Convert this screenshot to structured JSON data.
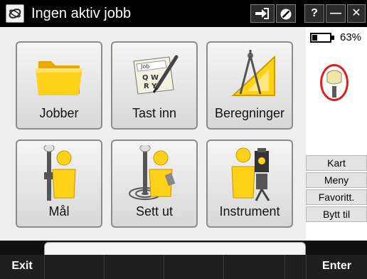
{
  "titlebar": {
    "title": "Ingen aktiv jobb",
    "app_icon": "trimble-logo-icon",
    "help_label": "?",
    "minimize_label": "—",
    "close_label": "✕"
  },
  "status": {
    "battery_percent": "63%",
    "battery_level": 0.63
  },
  "tiles": [
    {
      "label": "Jobber",
      "icon": "folder-icon"
    },
    {
      "label": "Tast inn",
      "icon": "keyin-card-icon"
    },
    {
      "label": "Beregninger",
      "icon": "compass-triangle-icon"
    },
    {
      "label": "Mål",
      "icon": "surveyor-measure-icon"
    },
    {
      "label": "Sett ut",
      "icon": "surveyor-stakeout-icon"
    },
    {
      "label": "Instrument",
      "icon": "surveyor-instrument-icon"
    }
  ],
  "side_buttons": [
    "Kart",
    "Meny",
    "Favoritt.",
    "Bytt til"
  ],
  "softkeys": {
    "left": "Exit",
    "right": "Enter"
  }
}
